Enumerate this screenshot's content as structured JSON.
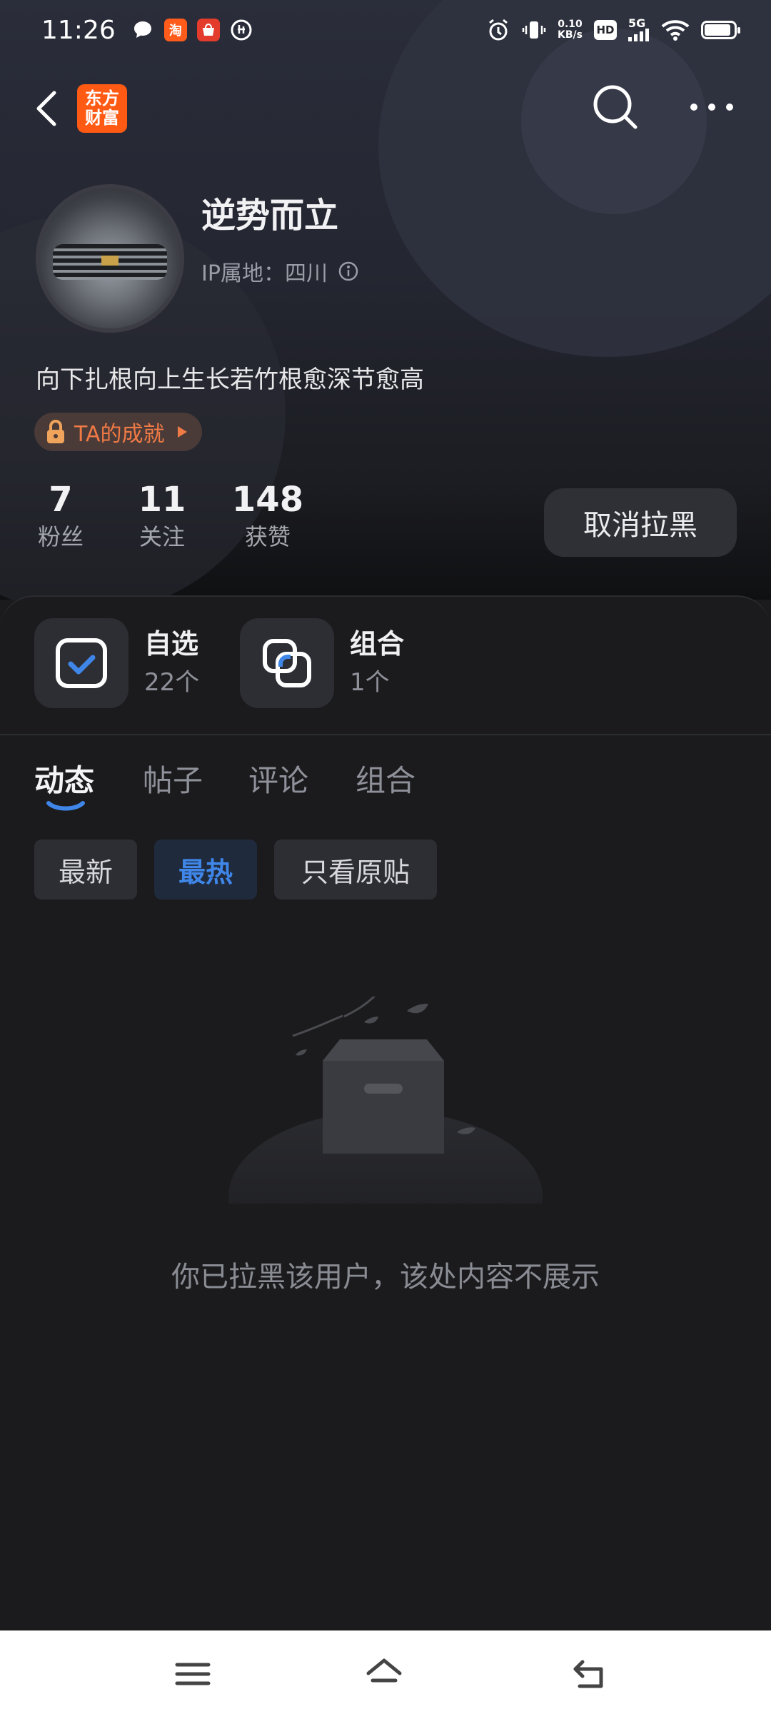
{
  "status_bar": {
    "time": "11:26",
    "net_speed_value": "0.10",
    "net_speed_unit": "KB/s",
    "hd": "HD",
    "signal": "5G",
    "battery_level": 0.9
  },
  "nav": {
    "logo_line1": "东方",
    "logo_line2": "财富"
  },
  "profile": {
    "username": "逆势而立",
    "ip_location": "IP属地：四川",
    "bio": "向下扎根向上生长若竹根愈深节愈高",
    "achievement_label": "TA的成就"
  },
  "stats": [
    {
      "value": "7",
      "label": "粉丝"
    },
    {
      "value": "11",
      "label": "关注"
    },
    {
      "value": "148",
      "label": "获赞"
    }
  ],
  "unblock_button": "取消拉黑",
  "quick_entries": [
    {
      "title": "自选",
      "sub": "22个",
      "icon": "watchlist-check-icon"
    },
    {
      "title": "组合",
      "sub": "1个",
      "icon": "portfolio-icon"
    }
  ],
  "tabs": [
    {
      "label": "动态",
      "active": true
    },
    {
      "label": "帖子",
      "active": false
    },
    {
      "label": "评论",
      "active": false
    },
    {
      "label": "组合",
      "active": false
    }
  ],
  "filters": [
    {
      "label": "最新",
      "active": false
    },
    {
      "label": "最热",
      "active": true
    },
    {
      "label": "只看原贴",
      "active": false
    }
  ],
  "empty_message": "你已拉黑该用户，该处内容不展示",
  "colors": {
    "accent_blue": "#3f86e8",
    "achievement_orange": "#f07a45",
    "brand_orange": "#ff5a14"
  }
}
